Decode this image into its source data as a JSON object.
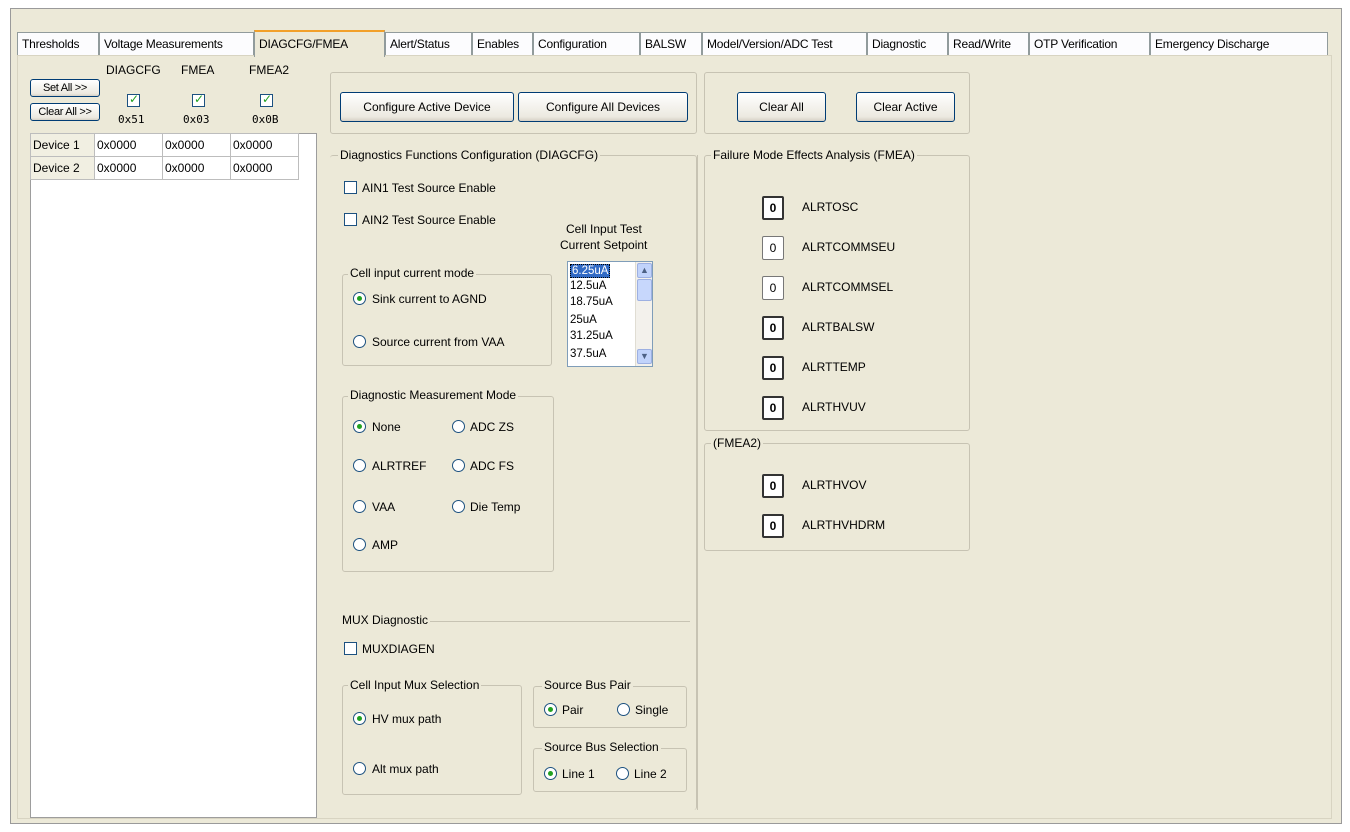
{
  "tabs": [
    "Thresholds",
    "Voltage Measurements",
    "DIAGCFG/FMEA",
    "Alert/Status",
    "Enables",
    "Configuration",
    "BALSW",
    "Model/Version/ADC Test",
    "Diagnostic",
    "Read/Write",
    "OTP Verification",
    "Emergency Discharge"
  ],
  "active_tab": "DIAGCFG/FMEA",
  "register_grid": {
    "set_all_label": "Set All >>",
    "clear_all_label": "Clear All >>",
    "columns": [
      {
        "name": "DIAGCFG",
        "checked": true,
        "address": "0x51"
      },
      {
        "name": "FMEA",
        "checked": true,
        "address": "0x03"
      },
      {
        "name": "FMEA2",
        "checked": true,
        "address": "0x0B"
      }
    ],
    "rows": [
      {
        "device": "Device 1",
        "values": [
          "0x0000",
          "0x0000",
          "0x0000"
        ]
      },
      {
        "device": "Device 2",
        "values": [
          "0x0000",
          "0x0000",
          "0x0000"
        ]
      }
    ]
  },
  "buttons": {
    "configure_active": "Configure Active Device",
    "configure_all": "Configure All Devices",
    "clear_all": "Clear All",
    "clear_active": "Clear Active"
  },
  "diagcfg": {
    "title": "Diagnostics Functions Configuration (DIAGCFG)",
    "ain1": {
      "label": "AIN1 Test Source Enable",
      "checked": false
    },
    "ain2": {
      "label": "AIN2 Test Source Enable",
      "checked": false
    },
    "setpoint_label_1": "Cell Input Test",
    "setpoint_label_2": "Current Setpoint",
    "setpoints": [
      "6.25uA",
      "12.5uA",
      "18.75uA",
      "25uA",
      "31.25uA",
      "37.5uA"
    ],
    "setpoint_selected": "6.25uA",
    "current_mode": {
      "title": "Cell input current mode",
      "options": [
        "Sink current to AGND",
        "Source current from VAA"
      ],
      "selected": "Sink current to AGND"
    },
    "measurement_mode": {
      "title": "Diagnostic Measurement Mode",
      "options": [
        "None",
        "ADC ZS",
        "ALRTREF",
        "ADC FS",
        "VAA",
        "Die Temp",
        "AMP"
      ],
      "selected": "None"
    },
    "mux": {
      "title": "MUX Diagnostic",
      "muxdiagen": {
        "label": "MUXDIAGEN",
        "checked": false
      },
      "input_selection": {
        "title": "Cell Input Mux Selection",
        "options": [
          "HV mux path",
          "Alt mux path"
        ],
        "selected": "HV mux path"
      },
      "bus_pair": {
        "title": "Source Bus Pair",
        "options": [
          "Pair",
          "Single"
        ],
        "selected": "Pair"
      },
      "bus_selection": {
        "title": "Source Bus Selection",
        "options": [
          "Line 1",
          "Line 2"
        ],
        "selected": "Line 1"
      }
    }
  },
  "fmea": {
    "title": "Failure Mode Effects Analysis (FMEA)",
    "items": [
      {
        "value": "0",
        "label": "ALRTOSC"
      },
      {
        "value": "0",
        "label": "ALRTCOMMSEU"
      },
      {
        "value": "0",
        "label": "ALRTCOMMSEL"
      },
      {
        "value": "0",
        "label": "ALRTBALSW"
      },
      {
        "value": "0",
        "label": "ALRTTEMP"
      },
      {
        "value": "0",
        "label": "ALRTHVUV"
      }
    ]
  },
  "fmea2": {
    "title": "(FMEA2)",
    "items": [
      {
        "value": "0",
        "label": "ALRTHVOV"
      },
      {
        "value": "0",
        "label": "ALRTHVHDRM"
      }
    ]
  },
  "colors": {
    "panel": "#ece9d8",
    "accent_tab": "#f2a02a",
    "radio_dot": "#21a121",
    "list_select": "#316ac5"
  }
}
